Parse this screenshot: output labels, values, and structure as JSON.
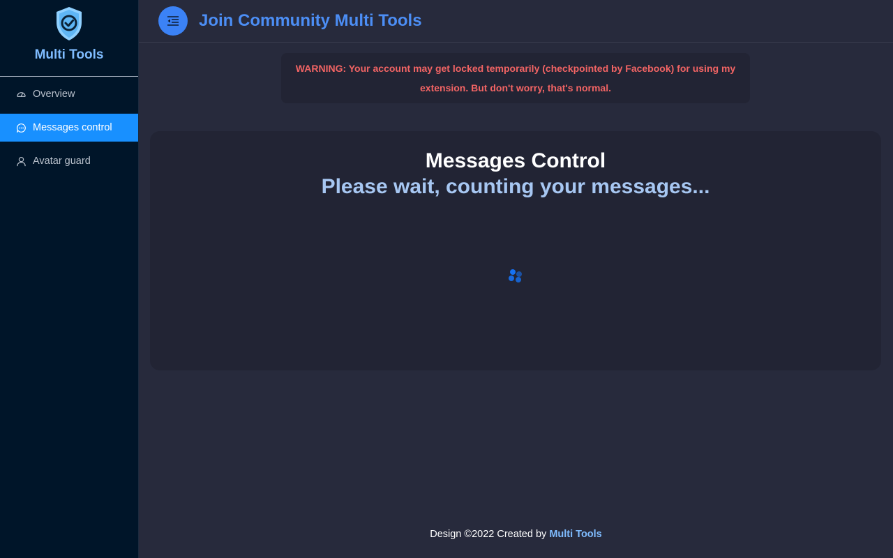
{
  "sidebar": {
    "brand_title": "Multi Tools",
    "logo_icon": "shield-check-icon",
    "items": [
      {
        "label": "Overview",
        "icon": "dashboard-icon",
        "active": false
      },
      {
        "label": "Messages control",
        "icon": "message-icon",
        "active": true
      },
      {
        "label": "Avatar guard",
        "icon": "user-icon",
        "active": false
      }
    ]
  },
  "header": {
    "toggle_icon": "menu-fold-icon",
    "title": "Join Community Multi Tools"
  },
  "warning": {
    "text": "WARNING: Your account may get locked temporarily (checkpointed by Facebook) for using my extension. But don't worry, that's normal."
  },
  "card": {
    "title": "Messages Control",
    "subtitle": "Please wait, counting your messages...",
    "loading_icon": "loading-spinner-icon"
  },
  "footer": {
    "prefix": "Design ©2022 Created by ",
    "link_text": "Multi Tools"
  },
  "colors": {
    "accent": "#1890ff",
    "warning": "#f26464",
    "sidebar_bg": "#001529",
    "page_bg": "#272a3c",
    "brand": "#7fbcff"
  }
}
